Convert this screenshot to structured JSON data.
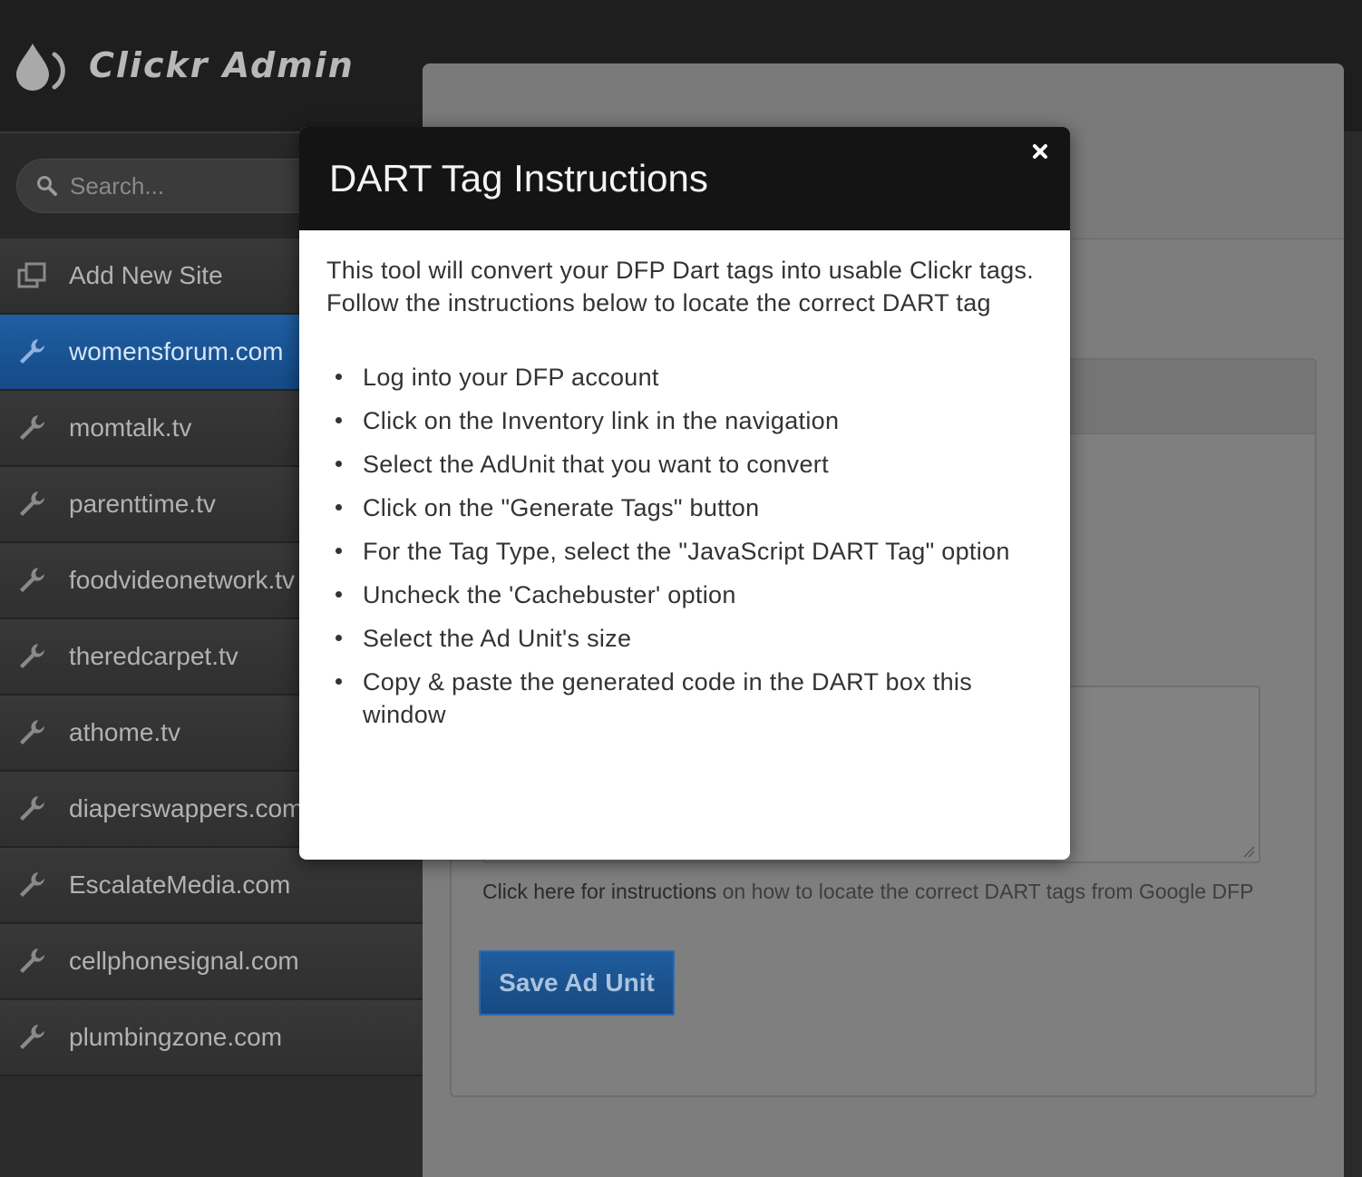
{
  "app": {
    "title": "Clickr Admin",
    "brand_icon": "clickr-drop-icon"
  },
  "search": {
    "placeholder": "Search..."
  },
  "sidebar": {
    "items": [
      {
        "label": "Add New Site",
        "icon": "windows-icon",
        "active": false
      },
      {
        "label": "womensforum.com",
        "icon": "wrench-icon",
        "active": true
      },
      {
        "label": "momtalk.tv",
        "icon": "wrench-icon",
        "active": false
      },
      {
        "label": "parenttime.tv",
        "icon": "wrench-icon",
        "active": false
      },
      {
        "label": "foodvideonetwork.tv",
        "icon": "wrench-icon",
        "active": false
      },
      {
        "label": "theredcarpet.tv",
        "icon": "wrench-icon",
        "active": false
      },
      {
        "label": "athome.tv",
        "icon": "wrench-icon",
        "active": false
      },
      {
        "label": "diaperswappers.com",
        "icon": "wrench-icon",
        "active": false
      },
      {
        "label": "EscalateMedia.com",
        "icon": "wrench-icon",
        "active": false
      },
      {
        "label": "cellphonesignal.com",
        "icon": "wrench-icon",
        "active": false
      },
      {
        "label": "plumbingzone.com",
        "icon": "wrench-icon",
        "active": false
      }
    ]
  },
  "main": {
    "help_link": "Click here for instructions",
    "help_rest": " on how to locate the correct DART tags from Google DFP",
    "save_label": "Save Ad Unit"
  },
  "modal": {
    "title": "DART Tag Instructions",
    "close_icon": "close-icon",
    "intro": "This tool will convert your DFP Dart tags into usable Clickr tags. Follow the instructions below to locate the correct DART tag",
    "steps": [
      "Log into your DFP account",
      "Click on the Inventory link in the navigation",
      "Select the AdUnit that you want to convert",
      "Click on the \"Generate Tags\" button",
      "For the Tag Type, select the \"JavaScript DART Tag\" option",
      "Uncheck the 'Cachebuster' option",
      "Select the Ad Unit's size",
      "Copy & paste the generated code in the DART box this window"
    ]
  },
  "colors": {
    "accent": "#1f5fa3",
    "header_dark": "#141414",
    "sidebar": "#2c2c2c"
  }
}
